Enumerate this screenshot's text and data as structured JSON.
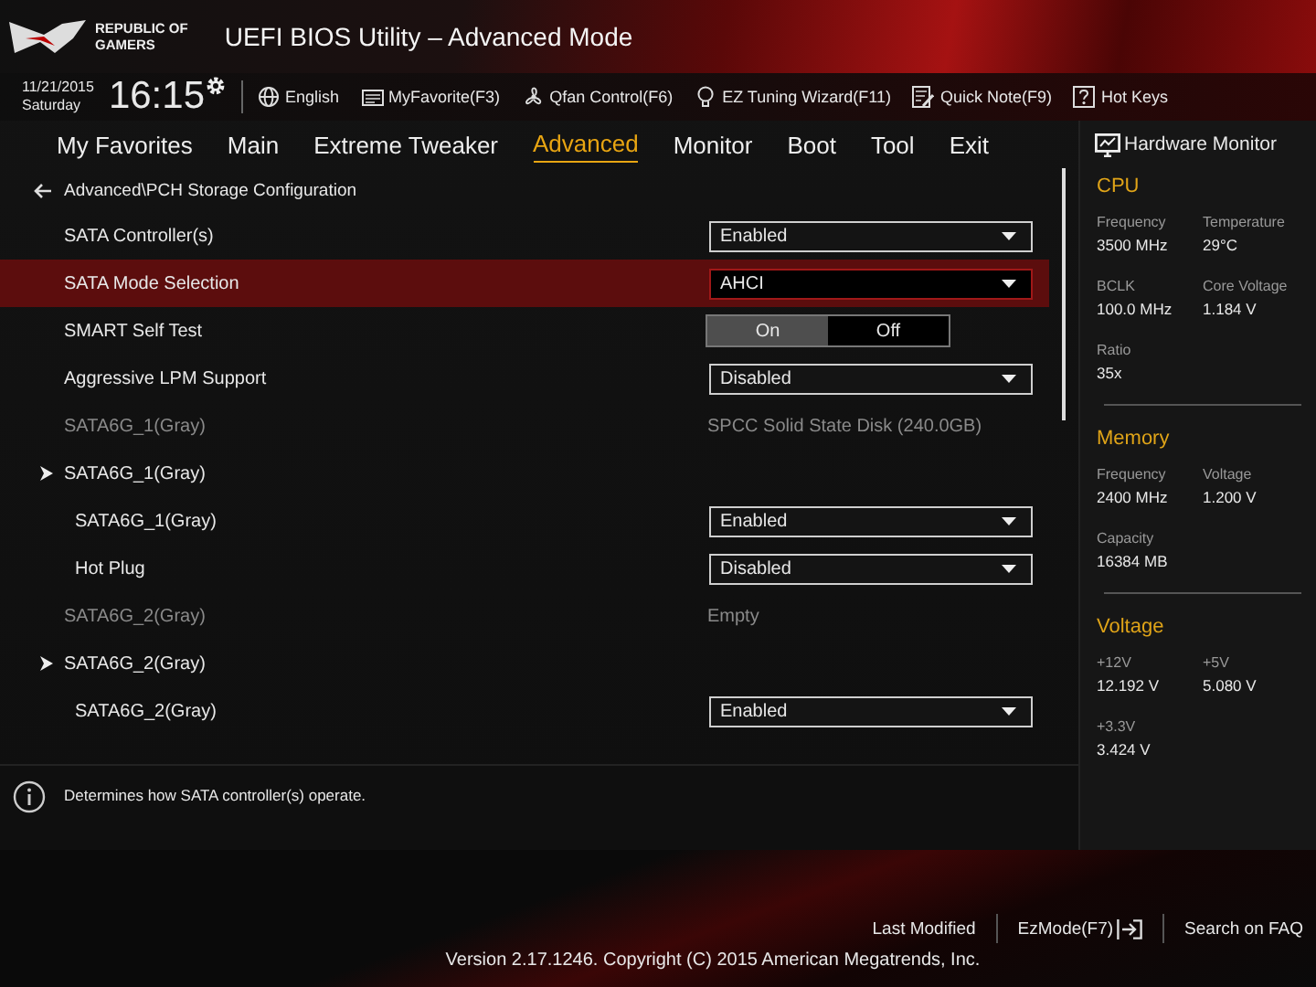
{
  "header": {
    "logo_lines": [
      "REPUBLIC OF",
      "GAMERS"
    ],
    "title": "UEFI BIOS Utility – Advanced Mode"
  },
  "toolbar": {
    "date": "11/21/2015",
    "day": "Saturday",
    "time": "16:15",
    "items": [
      {
        "label": "English"
      },
      {
        "label": "MyFavorite(F3)"
      },
      {
        "label": "Qfan Control(F6)"
      },
      {
        "label": "EZ Tuning Wizard(F11)"
      },
      {
        "label": "Quick Note(F9)"
      },
      {
        "label": "Hot Keys"
      }
    ]
  },
  "tabs": [
    {
      "label": "My Favorites",
      "selected": false
    },
    {
      "label": "Main",
      "selected": false
    },
    {
      "label": "Extreme Tweaker",
      "selected": false
    },
    {
      "label": "Advanced",
      "selected": true
    },
    {
      "label": "Monitor",
      "selected": false
    },
    {
      "label": "Boot",
      "selected": false
    },
    {
      "label": "Tool",
      "selected": false
    },
    {
      "label": "Exit",
      "selected": false
    }
  ],
  "breadcrumb": "Advanced\\PCH Storage Configuration",
  "settings": [
    {
      "kind": "dropdown",
      "label": "SATA Controller(s)",
      "value": "Enabled",
      "selected": false
    },
    {
      "kind": "dropdown",
      "label": "SATA Mode Selection",
      "value": "AHCI",
      "selected": true
    },
    {
      "kind": "toggle",
      "label": "SMART Self Test",
      "selected": false,
      "options": [
        {
          "label": "On",
          "selected": true
        },
        {
          "label": "Off",
          "selected": false
        }
      ]
    },
    {
      "kind": "dropdown",
      "label": "Aggressive LPM Support",
      "value": "Disabled",
      "selected": false
    },
    {
      "kind": "info",
      "label": "SATA6G_1(Gray)",
      "value": "SPCC Solid State Disk (240.0GB)",
      "selected": false
    },
    {
      "kind": "submenu",
      "label": "SATA6G_1(Gray)",
      "selected": false,
      "children": [
        {
          "kind": "dropdown",
          "label": "SATA6G_1(Gray)",
          "value": "Enabled",
          "selected": false
        },
        {
          "kind": "dropdown",
          "label": "Hot Plug",
          "value": "Disabled",
          "selected": false
        }
      ]
    },
    {
      "kind": "info",
      "label": "SATA6G_2(Gray)",
      "value": "Empty",
      "selected": false
    },
    {
      "kind": "submenu",
      "label": "SATA6G_2(Gray)",
      "selected": false,
      "children": [
        {
          "kind": "dropdown",
          "label": "SATA6G_2(Gray)",
          "value": "Enabled",
          "selected": false
        }
      ]
    }
  ],
  "help": "Determines how SATA controller(s) operate.",
  "hardware_monitor": {
    "title": "Hardware Monitor",
    "sections": [
      {
        "name": "CPU",
        "items": [
          {
            "label": "Frequency",
            "value": "3500 MHz"
          },
          {
            "label": "Temperature",
            "value": "29°C"
          },
          {
            "label": "BCLK",
            "value": "100.0 MHz"
          },
          {
            "label": "Core Voltage",
            "value": "1.184 V"
          },
          {
            "label": "Ratio",
            "value": "35x"
          }
        ]
      },
      {
        "name": "Memory",
        "items": [
          {
            "label": "Frequency",
            "value": "2400 MHz"
          },
          {
            "label": "Voltage",
            "value": "1.200 V"
          },
          {
            "label": "Capacity",
            "value": "16384 MB"
          }
        ]
      },
      {
        "name": "Voltage",
        "items": [
          {
            "label": "+12V",
            "value": "12.192 V"
          },
          {
            "label": "+5V",
            "value": "5.080 V"
          },
          {
            "label": "+3.3V",
            "value": "3.424 V"
          }
        ]
      }
    ]
  },
  "footer": {
    "links": [
      {
        "label": "Last Modified"
      },
      {
        "label": "EzMode(F7)"
      },
      {
        "label": "Search on FAQ"
      }
    ],
    "version": "Version 2.17.1246. Copyright (C) 2015 American Megatrends, Inc."
  }
}
